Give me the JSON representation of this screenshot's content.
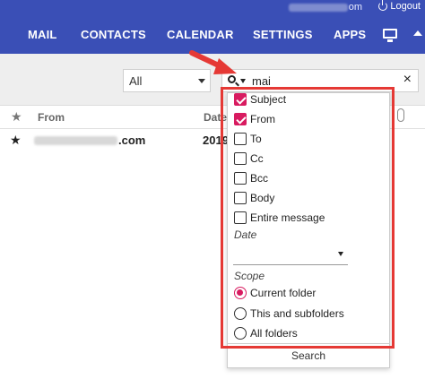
{
  "topbar": {
    "account_suffix": "om",
    "logout_label": "Logout",
    "nav": [
      {
        "label": "MAIL"
      },
      {
        "label": "CONTACTS"
      },
      {
        "label": "CALENDAR"
      },
      {
        "label": "SETTINGS"
      },
      {
        "label": "APPS"
      }
    ],
    "icons": {
      "logout": "power-icon",
      "desktop": "monitor-icon",
      "collapse": "caret-up-icon"
    }
  },
  "filter": {
    "select_value": "All",
    "search_value": "mai",
    "clear_symbol": "×"
  },
  "list": {
    "headers": {
      "from": "From",
      "date": "Date"
    },
    "rows": [
      {
        "from_domain": ".com",
        "date": "2019"
      }
    ]
  },
  "search_options": {
    "fields": [
      {
        "label": "Subject",
        "checked": true
      },
      {
        "label": "From",
        "checked": true
      },
      {
        "label": "To",
        "checked": false
      },
      {
        "label": "Cc",
        "checked": false
      },
      {
        "label": "Bcc",
        "checked": false
      },
      {
        "label": "Body",
        "checked": false
      },
      {
        "label": "Entire message",
        "checked": false
      }
    ],
    "date_label": "Date",
    "date_value": "",
    "scope_label": "Scope",
    "scopes": [
      {
        "label": "Current folder",
        "selected": true
      },
      {
        "label": "This and subfolders",
        "selected": false
      },
      {
        "label": "All folders",
        "selected": false
      }
    ],
    "search_button": "Search"
  },
  "colors": {
    "header_bg": "#3a4fb6",
    "accent": "#d81b60",
    "annotation": "#e53935"
  }
}
